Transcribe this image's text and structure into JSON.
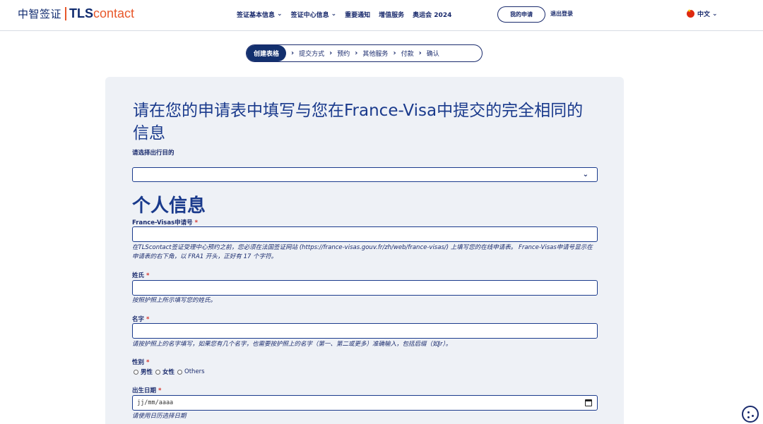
{
  "header": {
    "logo_cn": "中智签证",
    "logo_tls": "TLS",
    "logo_contact": "contact",
    "nav": [
      {
        "label": "签证基本信息",
        "dropdown": true
      },
      {
        "label": "签证中心信息",
        "dropdown": true
      },
      {
        "label": "重要通知",
        "dropdown": false
      },
      {
        "label": "增值服务",
        "dropdown": false
      },
      {
        "label": "奥运会 2024",
        "dropdown": false
      }
    ],
    "my_application": "我的申请",
    "logout": "退出登录",
    "language": "中文"
  },
  "stepper": [
    "创建表格",
    "提交方式",
    "预约",
    "其他服务",
    "付款",
    "确认"
  ],
  "form": {
    "title": "请在您的申请表中填写与您在France-Visa中提交的完全相同的信息",
    "purpose_label": "请选择出行目的",
    "purpose_value": "",
    "section_personal": "个人信息",
    "france_visas_label": "France-Visas申请号",
    "france_visas_hint": "在TLScontact签证受理中心预约之前，您必须在法国签证网站 (https://france-visas.gouv.fr/zh/web/france-visas/) 上填写您的在线申请表。 France-Visas申请号显示在申请表的右下角，以 FRA1 开头，正好有 17 个字符。",
    "surname_label": "姓氏",
    "surname_hint": "按照护照上所示填写您的姓氏。",
    "firstname_label": "名字",
    "firstname_hint": "请按护照上的名字填写，如果您有几个名字，也需要按护照上的名字（第一、第二或更多）准确输入，包括后缀（如Jr）。",
    "gender_label": "性别",
    "gender_options": [
      "男性",
      "女性",
      "Others"
    ],
    "dob_label": "出生日期",
    "dob_placeholder": "jj/mm/aaaa",
    "dob_hint": "请使用日历选择日期",
    "required_mark": "*"
  },
  "colors": {
    "primary": "#1a2b6d",
    "accent": "#e8582b",
    "required": "#d4342c",
    "card_bg": "#eef1f6"
  }
}
